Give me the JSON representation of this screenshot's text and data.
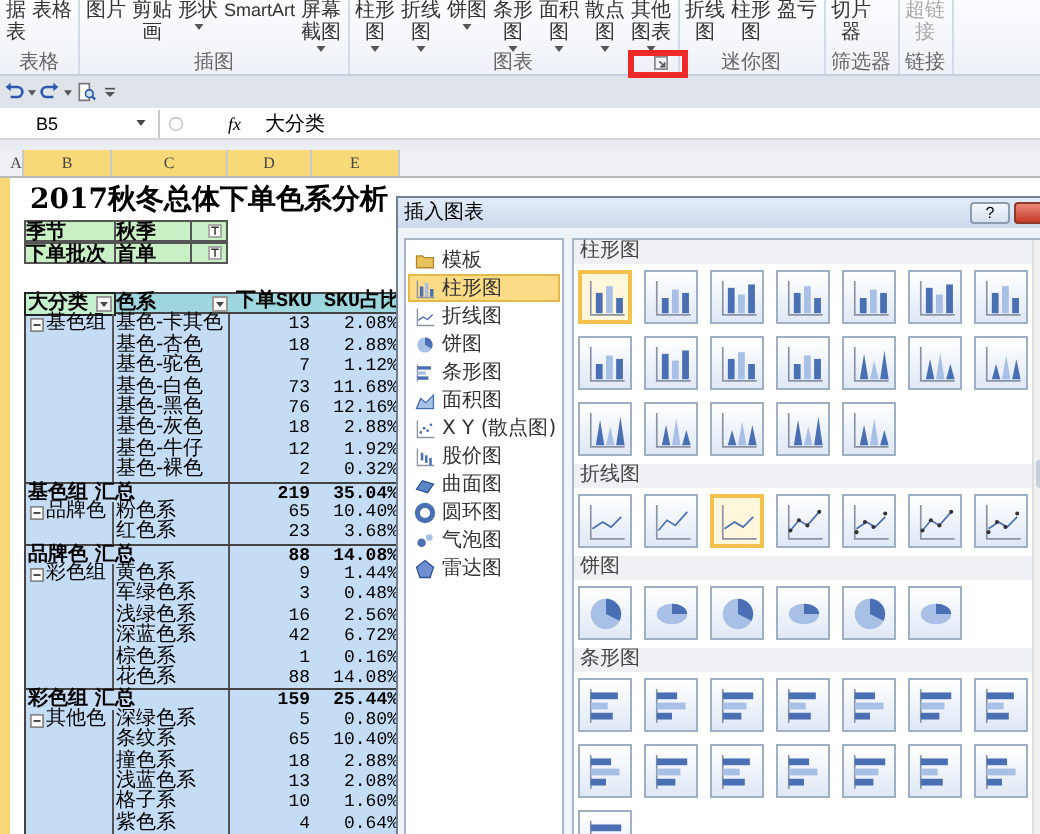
{
  "ribbon": {
    "groups": [
      {
        "label": "表格",
        "buttons": [
          {
            "label": "据表",
            "dropdown": false,
            "disabled": false
          },
          {
            "label": "表格",
            "dropdown": false,
            "disabled": false
          }
        ]
      },
      {
        "label": "插图",
        "buttons": [
          {
            "label": "图片",
            "dropdown": false,
            "disabled": false
          },
          {
            "label": "剪贴画",
            "dropdown": false,
            "disabled": false
          },
          {
            "label": "形状",
            "dropdown": true,
            "disabled": false
          },
          {
            "label": "SmartArt",
            "dropdown": false,
            "disabled": false
          },
          {
            "label": "屏幕截图",
            "dropdown": true,
            "disabled": false
          }
        ]
      },
      {
        "label": "图表",
        "launcher": {
          "highlighted": true
        },
        "buttons": [
          {
            "label": "柱形图",
            "dropdown": true,
            "disabled": false
          },
          {
            "label": "折线图",
            "dropdown": true,
            "disabled": false
          },
          {
            "label": "饼图",
            "dropdown": true,
            "disabled": false
          },
          {
            "label": "条形图",
            "dropdown": true,
            "disabled": false
          },
          {
            "label": "面积图",
            "dropdown": true,
            "disabled": false
          },
          {
            "label": "散点图",
            "dropdown": true,
            "disabled": false
          },
          {
            "label": "其他图表",
            "dropdown": true,
            "disabled": false
          }
        ]
      },
      {
        "label": "迷你图",
        "buttons": [
          {
            "label": "折线图",
            "dropdown": false,
            "disabled": false
          },
          {
            "label": "柱形图",
            "dropdown": false,
            "disabled": false
          },
          {
            "label": "盈亏",
            "dropdown": false,
            "disabled": false
          }
        ]
      },
      {
        "label": "筛选器",
        "buttons": [
          {
            "label": "切片器",
            "dropdown": false,
            "disabled": false
          }
        ]
      },
      {
        "label": "链接",
        "buttons": [
          {
            "label": "超链接",
            "dropdown": false,
            "disabled": true
          }
        ]
      }
    ]
  },
  "formula_bar": {
    "name_box": "B5",
    "function_symbol": "fx",
    "content": "大分类"
  },
  "sheet": {
    "columns": [
      {
        "label": "A",
        "selected": false
      },
      {
        "label": "B",
        "selected": true
      },
      {
        "label": "C",
        "selected": true
      },
      {
        "label": "D",
        "selected": true
      },
      {
        "label": "E",
        "selected": true
      }
    ],
    "title": "2017秋冬总体下单色系分析",
    "filters": [
      {
        "field": "季节",
        "value": "秋季"
      },
      {
        "field": "下单批次",
        "value": "首单"
      }
    ],
    "pivot": {
      "headers": [
        {
          "label": "大分类",
          "filter": true
        },
        {
          "label": "色系",
          "filter": true
        },
        {
          "label": "下单SKU",
          "filter": false
        },
        {
          "label": "SKU占比",
          "filter": false
        }
      ],
      "groups": [
        {
          "name": "基色组",
          "expanded": true,
          "items": [
            {
              "series": "基色-卡其色",
              "sku": "13",
              "share": "2.08%"
            },
            {
              "series": "基色-杏色",
              "sku": "18",
              "share": "2.88%"
            },
            {
              "series": "基色-驼色",
              "sku": "7",
              "share": "1.12%"
            },
            {
              "series": "基色-白色",
              "sku": "73",
              "share": "11.68%"
            },
            {
              "series": "基色-黑色",
              "sku": "76",
              "share": "12.16%"
            },
            {
              "series": "基色-灰色",
              "sku": "18",
              "share": "2.88%"
            },
            {
              "series": "基色-牛仔",
              "sku": "12",
              "share": "1.92%"
            },
            {
              "series": "基色-裸色",
              "sku": "2",
              "share": "0.32%"
            }
          ],
          "total": {
            "label": "基色组 汇总",
            "sku": "219",
            "share": "35.04%"
          }
        },
        {
          "name": "品牌色",
          "expanded": true,
          "items": [
            {
              "series": "粉色系",
              "sku": "65",
              "share": "10.40%"
            },
            {
              "series": "红色系",
              "sku": "23",
              "share": "3.68%"
            }
          ],
          "total": {
            "label": "品牌色 汇总",
            "sku": "88",
            "share": "14.08%"
          }
        },
        {
          "name": "彩色组",
          "expanded": true,
          "items": [
            {
              "series": "黄色系",
              "sku": "9",
              "share": "1.44%"
            },
            {
              "series": "军绿色系",
              "sku": "3",
              "share": "0.48%"
            },
            {
              "series": "浅绿色系",
              "sku": "16",
              "share": "2.56%"
            },
            {
              "series": "深蓝色系",
              "sku": "42",
              "share": "6.72%"
            },
            {
              "series": "棕色系",
              "sku": "1",
              "share": "0.16%"
            },
            {
              "series": "花色系",
              "sku": "88",
              "share": "14.08%"
            }
          ],
          "total": {
            "label": "彩色组 汇总",
            "sku": "159",
            "share": "25.44%"
          }
        },
        {
          "name": "其他色",
          "expanded": true,
          "items": [
            {
              "series": "深绿色系",
              "sku": "5",
              "share": "0.80%"
            },
            {
              "series": "条纹系",
              "sku": "65",
              "share": "10.40%"
            },
            {
              "series": "撞色系",
              "sku": "18",
              "share": "2.88%"
            },
            {
              "series": "浅蓝色系",
              "sku": "13",
              "share": "2.08%"
            },
            {
              "series": "格子系",
              "sku": "10",
              "share": "1.60%"
            },
            {
              "series": "紫色系",
              "sku": "4",
              "share": "0.64%"
            }
          ]
        }
      ]
    }
  },
  "dialog": {
    "title": "插入图表",
    "help": "?",
    "categories": [
      {
        "label": "模板",
        "selected": false
      },
      {
        "label": "柱形图",
        "selected": true
      },
      {
        "label": "折线图",
        "selected": false
      },
      {
        "label": "饼图",
        "selected": false
      },
      {
        "label": "条形图",
        "selected": false
      },
      {
        "label": "面积图",
        "selected": false
      },
      {
        "label": "X Y (散点图)",
        "selected": false
      },
      {
        "label": "股价图",
        "selected": false
      },
      {
        "label": "曲面图",
        "selected": false
      },
      {
        "label": "圆环图",
        "selected": false
      },
      {
        "label": "气泡图",
        "selected": false
      },
      {
        "label": "雷达图",
        "selected": false
      }
    ],
    "sections": [
      {
        "title": "柱形图",
        "kind": "column",
        "options": [
          {
            "selected": true
          },
          {
            "selected": false
          },
          {
            "selected": false
          },
          {
            "selected": false
          },
          {
            "selected": false
          },
          {
            "selected": false
          },
          {
            "selected": false
          },
          {
            "selected": false
          },
          {
            "selected": false
          },
          {
            "selected": false
          },
          {
            "selected": false
          },
          {
            "selected": false
          },
          {
            "selected": false
          },
          {
            "selected": false
          },
          {
            "selected": false
          },
          {
            "selected": false
          },
          {
            "selected": false
          },
          {
            "selected": false
          },
          {
            "selected": false
          }
        ]
      },
      {
        "title": "折线图",
        "kind": "line",
        "options": [
          {
            "selected": false
          },
          {
            "selected": false
          },
          {
            "selected": true
          },
          {
            "selected": false
          },
          {
            "selected": false
          },
          {
            "selected": false
          },
          {
            "selected": false
          }
        ]
      },
      {
        "title": "饼图",
        "kind": "pie",
        "options": [
          {
            "selected": false
          },
          {
            "selected": false
          },
          {
            "selected": false
          },
          {
            "selected": false
          },
          {
            "selected": false
          },
          {
            "selected": false
          }
        ]
      },
      {
        "title": "条形图",
        "kind": "bar",
        "options": [
          {
            "selected": false
          },
          {
            "selected": false
          },
          {
            "selected": false
          },
          {
            "selected": false
          },
          {
            "selected": false
          },
          {
            "selected": false
          },
          {
            "selected": false
          },
          {
            "selected": false
          },
          {
            "selected": false
          },
          {
            "selected": false
          },
          {
            "selected": false
          },
          {
            "selected": false
          },
          {
            "selected": false
          },
          {
            "selected": false
          },
          {
            "selected": false
          }
        ]
      }
    ]
  }
}
